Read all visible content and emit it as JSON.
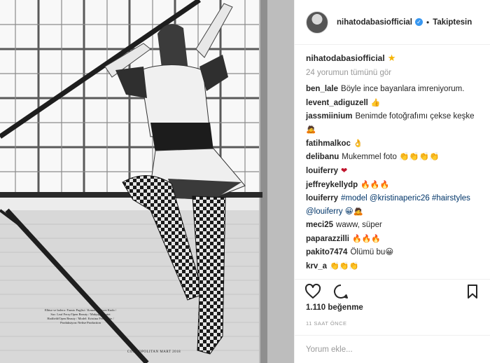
{
  "post": {
    "credits_text": "Elbise ve bolero: Fausto Puglisi / Kemer: Maison Kudo / Sac: Leaf Ferry/Open Beauty / Makyaj: Harriet Hadfield/Open Beauty / Model: Kristina Peric/Elite / Produksiyon: Nefise Production",
    "magazine_footer": "COSMOPOLITAN MART 2018"
  },
  "header": {
    "username": "nihatodabasiofficial",
    "separator": "•",
    "follow_status": "Takiptesin",
    "verified_glyph": "✓"
  },
  "caption": {
    "username": "nihatodabasiofficial",
    "star": "★"
  },
  "view_all": "24 yorumun tümünü gör",
  "comments": [
    {
      "user": "ben_lale",
      "text": "Böyle ince bayanlara imreniyorum."
    },
    {
      "user": "levent_adiguzell",
      "text": "👍"
    },
    {
      "user": "jassmiinium",
      "text": "Benimde fotoğrafımı çekse keşke🙇"
    },
    {
      "user": "fatihmalkoc",
      "text": "👌"
    },
    {
      "user": "delibanu",
      "text": "Mukemmel foto 👏👏👏👏"
    },
    {
      "user": "louiferry",
      "text": "❤"
    },
    {
      "user": "jeffreykellydp",
      "text": "🔥🔥🔥"
    },
    {
      "user": "louiferry",
      "text": "#model @kristinaperic26 #hairstyles @louiferry 😀🙇"
    },
    {
      "user": "meci25",
      "text": "waww, süper"
    },
    {
      "user": "paparazzilli",
      "text": "🔥🔥🔥"
    },
    {
      "user": "pakito7474",
      "text": "Ölümü bu😀"
    },
    {
      "user": "krv_a",
      "text": "👏👏👏"
    }
  ],
  "icons": {
    "like": "heart-outline-icon",
    "comment": "comment-bubble-icon",
    "save": "bookmark-icon"
  },
  "likes": "1.110 beğenme",
  "timestamp": "11 SAAT ÖNCE",
  "comment_input": {
    "placeholder": "Yorum ekle..."
  },
  "colors": {
    "verified": "#3897f0",
    "hashtag": "#003569",
    "muted": "#999999",
    "star": "#f5b300"
  }
}
